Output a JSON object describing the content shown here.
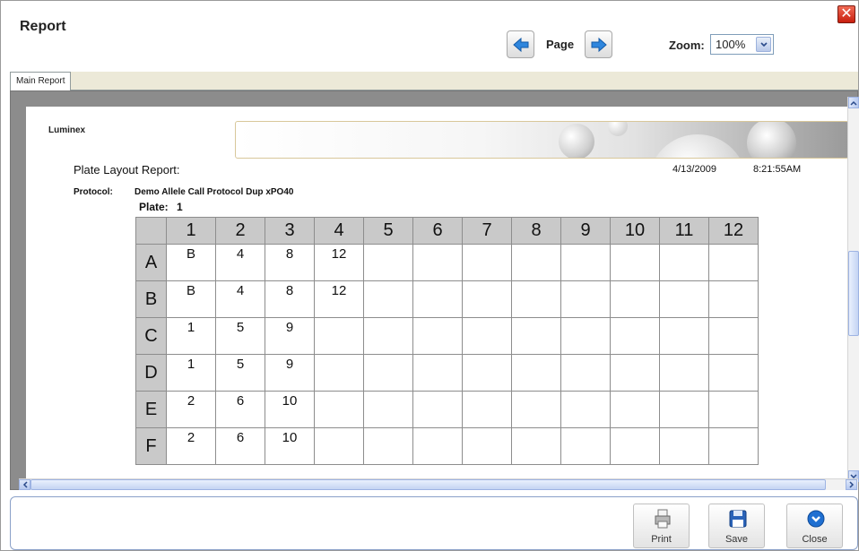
{
  "window": {
    "title": "Report",
    "close_label": "✕"
  },
  "toolbar": {
    "page_label": "Page",
    "zoom_label": "Zoom:",
    "zoom_value": "100%",
    "prev_icon": "arrow-left-icon",
    "next_icon": "arrow-right-icon"
  },
  "tabs": [
    {
      "label": "Main Report"
    }
  ],
  "report": {
    "brand": "Luminex",
    "title": "Plate Layout Report:",
    "date": "4/13/2009",
    "time": "8:21:55AM",
    "protocol_label": "Protocol:",
    "protocol_value": "Demo Allele Call Protocol Dup xPO40",
    "plate_label": "Plate:",
    "plate_value": "1"
  },
  "plate": {
    "columns": [
      "1",
      "2",
      "3",
      "4",
      "5",
      "6",
      "7",
      "8",
      "9",
      "10",
      "11",
      "12"
    ],
    "rows": [
      {
        "label": "A",
        "cells": [
          "B",
          "4",
          "8",
          "12",
          "",
          "",
          "",
          "",
          "",
          "",
          "",
          ""
        ]
      },
      {
        "label": "B",
        "cells": [
          "B",
          "4",
          "8",
          "12",
          "",
          "",
          "",
          "",
          "",
          "",
          "",
          ""
        ]
      },
      {
        "label": "C",
        "cells": [
          "1",
          "5",
          "9",
          "",
          "",
          "",
          "",
          "",
          "",
          "",
          "",
          ""
        ]
      },
      {
        "label": "D",
        "cells": [
          "1",
          "5",
          "9",
          "",
          "",
          "",
          "",
          "",
          "",
          "",
          "",
          ""
        ]
      },
      {
        "label": "E",
        "cells": [
          "2",
          "6",
          "10",
          "",
          "",
          "",
          "",
          "",
          "",
          "",
          "",
          ""
        ]
      },
      {
        "label": "F",
        "cells": [
          "2",
          "6",
          "10",
          "",
          "",
          "",
          "",
          "",
          "",
          "",
          "",
          ""
        ]
      }
    ]
  },
  "footer": {
    "print_label": "Print",
    "save_label": "Save",
    "close_label": "Close"
  },
  "colors": {
    "accent": "#1f6fd1",
    "header_cell": "#c9c9c9",
    "close_red": "#d8321e"
  }
}
